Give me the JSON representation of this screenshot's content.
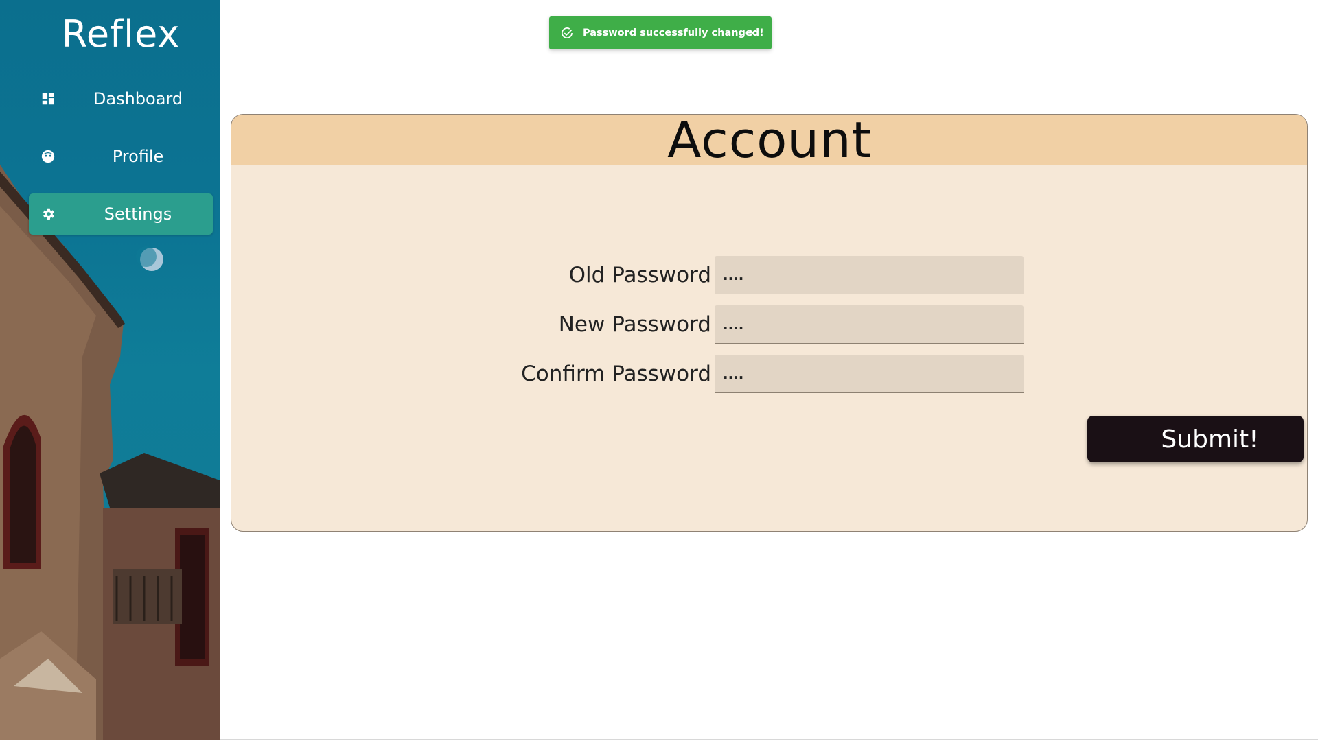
{
  "sidebar": {
    "brand": "Reflex",
    "items": [
      {
        "label": "Dashboard",
        "icon": "dashboard-icon",
        "active": false
      },
      {
        "label": "Profile",
        "icon": "face-icon",
        "active": false
      },
      {
        "label": "Settings",
        "icon": "gear-icon",
        "active": true
      }
    ]
  },
  "toast": {
    "message": "Password successfully changed!",
    "icon": "check-circle-icon",
    "close_icon": "close-icon",
    "color": "#3fae48"
  },
  "account": {
    "title": "Account",
    "fields": [
      {
        "label": "Old Password",
        "placeholder": "...."
      },
      {
        "label": "New Password",
        "placeholder": "...."
      },
      {
        "label": "Confirm Password",
        "placeholder": "...."
      }
    ],
    "submit_label": "Submit!"
  },
  "colors": {
    "sidebar_bg": "#0c7493",
    "active_item": "#2b9e8e",
    "card_bg": "#f6e8d7",
    "card_header": "#f1d0a5",
    "input_bg": "#e2d5c5",
    "button_bg": "#1a1015"
  }
}
